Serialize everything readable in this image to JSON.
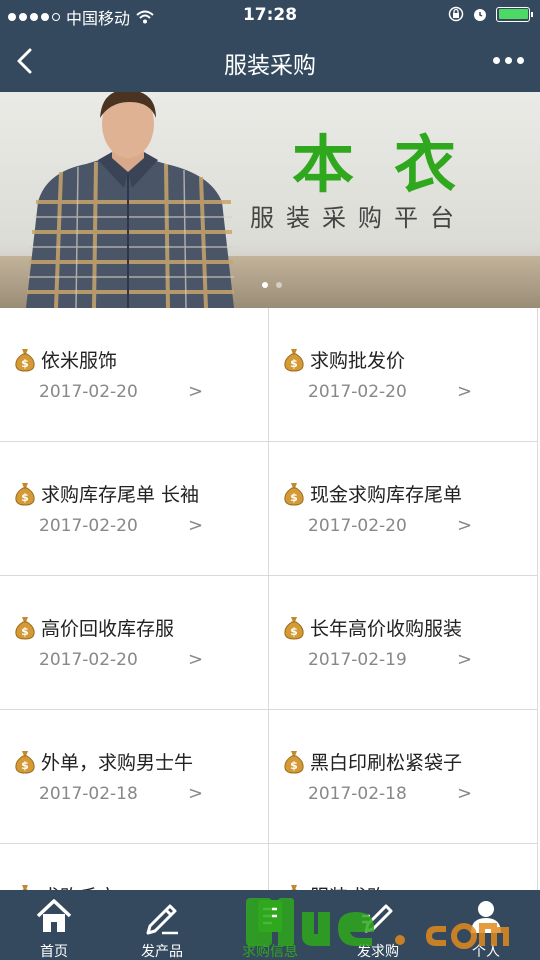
{
  "status_bar": {
    "carrier": "中国移动",
    "time": "17:28"
  },
  "nav": {
    "title": "服装采购"
  },
  "banner": {
    "brand": "本衣",
    "tagline": "服装采购平台"
  },
  "items": [
    {
      "name": "依米服饰",
      "date": "2017-02-20",
      "arrow": ">"
    },
    {
      "name": "求购批发价",
      "date": "2017-02-20",
      "arrow": ">"
    },
    {
      "name": "求购库存尾单 长袖",
      "date": "2017-02-20",
      "arrow": ">"
    },
    {
      "name": "现金求购库存尾单",
      "date": "2017-02-20",
      "arrow": ">"
    },
    {
      "name": "高价回收库存服",
      "date": "2017-02-20",
      "arrow": ">"
    },
    {
      "name": "长年高价收购服装",
      "date": "2017-02-19",
      "arrow": ">"
    },
    {
      "name": "外单，求购男士牛",
      "date": "2017-02-18",
      "arrow": ">"
    },
    {
      "name": "黑白印刷松紧袋子",
      "date": "2017-02-18",
      "arrow": ">"
    },
    {
      "name": "求购毛衣",
      "date": "",
      "arrow": ""
    },
    {
      "name": "服装求购",
      "date": "",
      "arrow": ""
    }
  ],
  "tabs": [
    {
      "label": "首页",
      "icon": "home-icon"
    },
    {
      "label": "发产品",
      "icon": "pencil-icon"
    },
    {
      "label": "求购信息",
      "icon": "list-icon",
      "active": true
    },
    {
      "label": "发求购",
      "icon": "edit-icon"
    },
    {
      "label": "个人",
      "icon": "user-icon"
    }
  ],
  "watermark": "51ue.com",
  "colors": {
    "bar": "#34495e",
    "accent": "#2fa81d",
    "date": "#888888"
  }
}
